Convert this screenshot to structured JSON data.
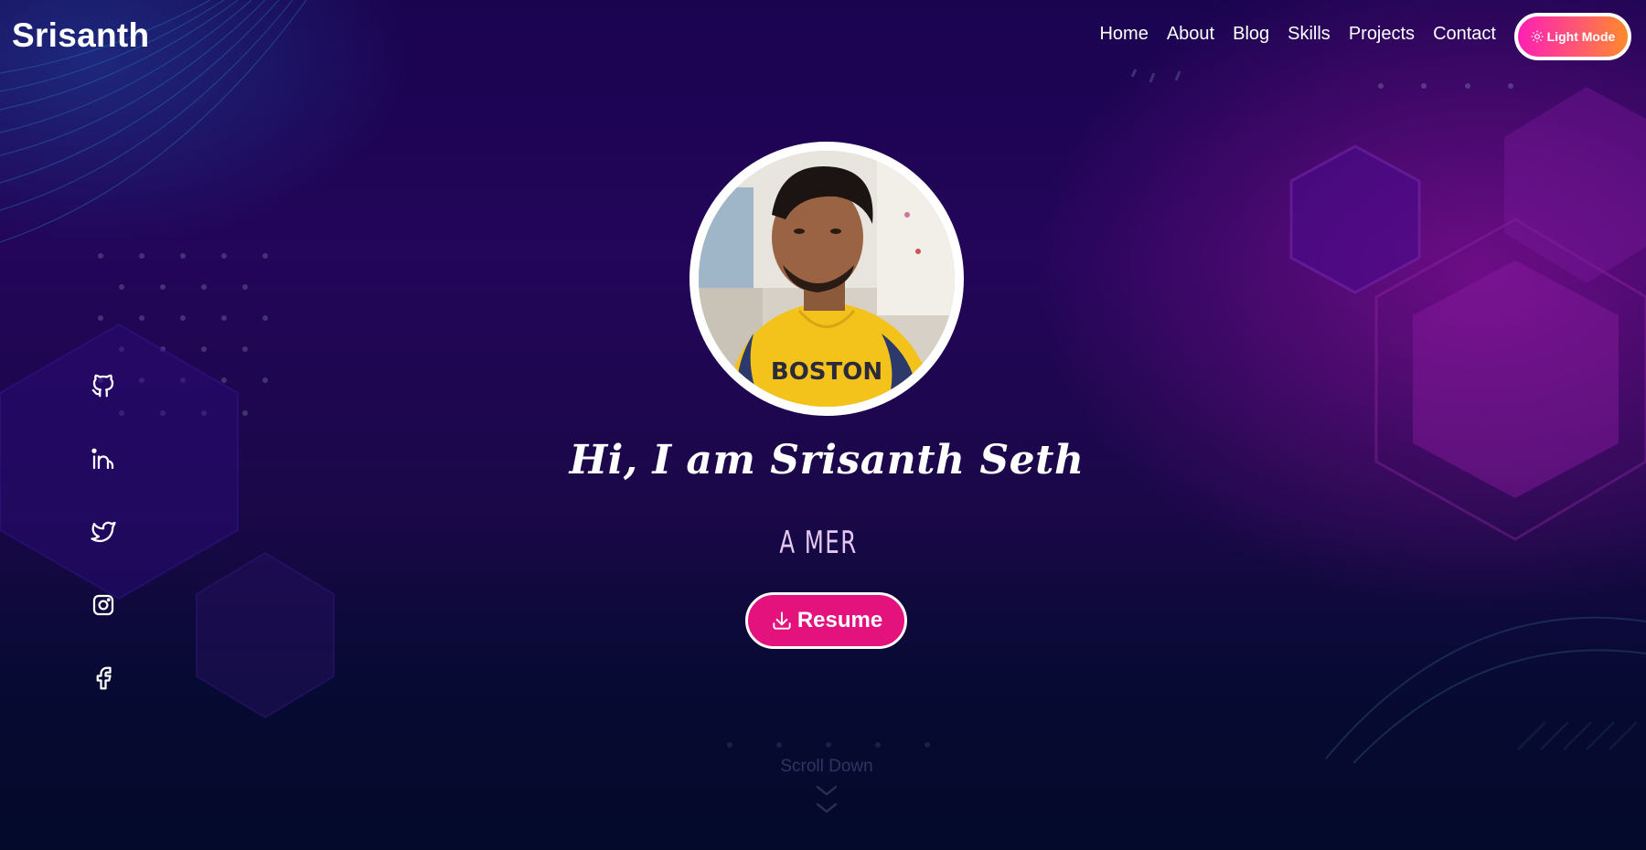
{
  "nav": {
    "logo": "Srisanth",
    "links": [
      "Home",
      "About",
      "Blog",
      "Skills",
      "Projects",
      "Contact"
    ],
    "theme_toggle_label": "Light Mode",
    "theme_toggle_icon": "sun-icon"
  },
  "social": [
    {
      "icon": "github-icon"
    },
    {
      "icon": "linkedin-icon"
    },
    {
      "icon": "twitter-icon"
    },
    {
      "icon": "instagram-icon"
    },
    {
      "icon": "facebook-icon"
    }
  ],
  "hero": {
    "greeting": "Hi, I am Srisanth Seth",
    "typed_text": "A MER",
    "resume_label": "Resume",
    "resume_icon": "download-icon"
  },
  "scroll": {
    "label": "Scroll Down",
    "icon": "chevron-down-icon"
  },
  "colors": {
    "accent_pink": "#e4127c",
    "toggle_gradient_start": "#ff1fb4",
    "toggle_gradient_end": "#ff8a2a",
    "background_top": "#1a0450",
    "background_bottom": "#040a2a"
  }
}
